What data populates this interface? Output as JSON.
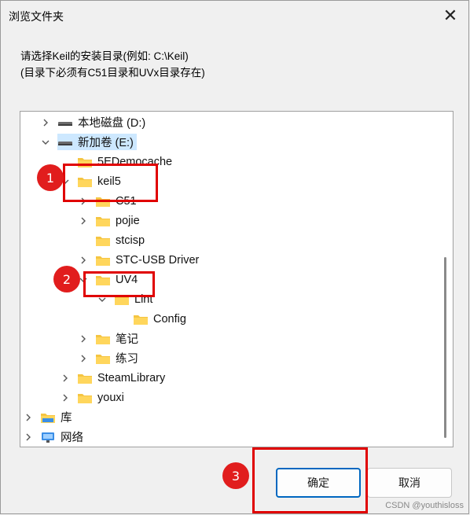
{
  "dialog": {
    "title": "浏览文件夹",
    "close_glyph": "✕",
    "description_line1": "请选择Keil的安装目录(例如: C:\\Keil)",
    "description_line2": "(目录下必须有C51目录和UVx目录存在)"
  },
  "tree": {
    "items": [
      {
        "label": "本地磁盘 (D:)",
        "icon": "drive-icon",
        "expander": "chevron-right"
      },
      {
        "label": "新加卷 (E:)",
        "icon": "drive-icon",
        "expander": "chevron-down",
        "selected": true
      },
      {
        "label": "5EDemocache",
        "icon": "folder-icon",
        "expander": "none"
      },
      {
        "label": "keil5",
        "icon": "folder-icon",
        "expander": "chevron-down"
      },
      {
        "label": "C51",
        "icon": "folder-icon",
        "expander": "chevron-right"
      },
      {
        "label": "pojie",
        "icon": "folder-icon",
        "expander": "chevron-right"
      },
      {
        "label": "stcisp",
        "icon": "folder-icon",
        "expander": "none"
      },
      {
        "label": "STC-USB Driver",
        "icon": "folder-icon",
        "expander": "chevron-right"
      },
      {
        "label": "UV4",
        "icon": "folder-icon",
        "expander": "chevron-down"
      },
      {
        "label": "Lint",
        "icon": "folder-icon",
        "expander": "chevron-down"
      },
      {
        "label": "Config",
        "icon": "folder-icon",
        "expander": "none"
      },
      {
        "label": "笔记",
        "icon": "folder-icon",
        "expander": "chevron-right"
      },
      {
        "label": "练习",
        "icon": "folder-icon",
        "expander": "chevron-right"
      },
      {
        "label": "SteamLibrary",
        "icon": "folder-icon",
        "expander": "chevron-right"
      },
      {
        "label": "youxi",
        "icon": "folder-icon",
        "expander": "chevron-right"
      },
      {
        "label": "库",
        "icon": "library-icon",
        "expander": "chevron-right"
      },
      {
        "label": "网络",
        "icon": "network-icon",
        "expander": "chevron-right"
      }
    ]
  },
  "buttons": {
    "ok_label": "确定",
    "cancel_label": "取消"
  },
  "annotations": {
    "badge1": "1",
    "badge2": "2",
    "badge3": "3"
  },
  "watermark": "CSDN @youthisloss",
  "colors": {
    "annotation_red": "#e11d1d",
    "folder_yellow": "#f5c542",
    "selection_blue": "#cde8ff",
    "accent_blue": "#0067c0"
  }
}
